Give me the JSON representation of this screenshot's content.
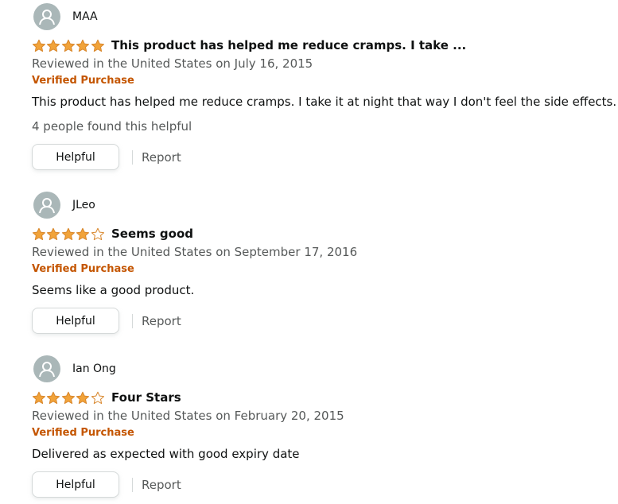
{
  "reviews": [
    {
      "profile_name": "MAA",
      "rating": 5,
      "title": "This product has helped me reduce cramps. I take ...",
      "date": "Reviewed in the United States on July 16, 2015",
      "verified_label": "Verified Purchase",
      "body": "This product has helped me reduce cramps. I take it at night that way I don't feel the side effects.",
      "helpful_count": "4 people found this helpful",
      "helpful_label": "Helpful",
      "report_label": "Report"
    },
    {
      "profile_name": "JLeo",
      "rating": 4,
      "title": "Seems good",
      "date": "Reviewed in the United States on September 17, 2016",
      "verified_label": "Verified Purchase",
      "body": "Seems like a good product.",
      "helpful_label": "Helpful",
      "report_label": "Report"
    },
    {
      "profile_name": "Ian Ong",
      "rating": 4,
      "title": "Four Stars",
      "date": "Reviewed in the United States on February 20, 2015",
      "verified_label": "Verified Purchase",
      "body": "Delivered as expected with good expiry date",
      "helpful_label": "Helpful",
      "report_label": "Report"
    }
  ],
  "colors": {
    "star_fill": "#f1a33a",
    "star_stroke": "#d8862b",
    "verified": "#c45500",
    "avatar_bg": "#aab7b8",
    "muted_text": "#565959"
  },
  "icons": {
    "avatar": "user-silhouette-icon",
    "star_full": "star-filled-icon",
    "star_empty": "star-empty-icon"
  }
}
